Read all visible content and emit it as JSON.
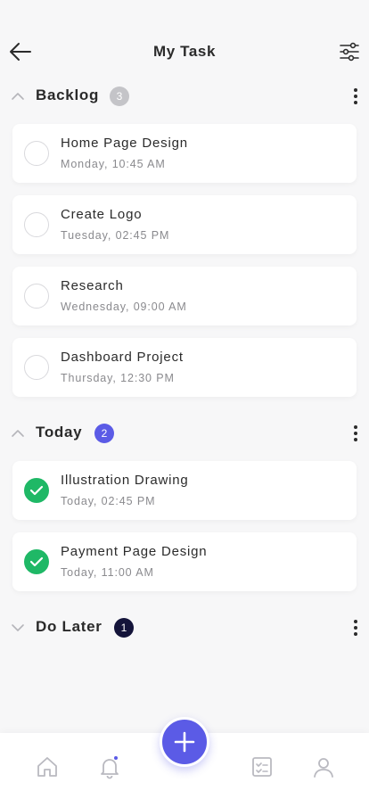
{
  "header": {
    "title": "My Task"
  },
  "sections": [
    {
      "label": "Backlog",
      "count": "3",
      "badge_color": "#c4c4c8",
      "expanded": true,
      "tasks": [
        {
          "name": "Home Page Design",
          "time": "Monday, 10:45 AM",
          "done": false
        },
        {
          "name": "Create Logo",
          "time": "Tuesday, 02:45 PM",
          "done": false
        },
        {
          "name": "Research",
          "time": "Wednesday, 09:00 AM",
          "done": false
        },
        {
          "name": "Dashboard Project",
          "time": "Thursday, 12:30 PM",
          "done": false
        }
      ]
    },
    {
      "label": "Today",
      "count": "2",
      "badge_color": "#5b5be6",
      "expanded": true,
      "tasks": [
        {
          "name": "Illustration Drawing",
          "time": "Today, 02:45 PM",
          "done": true
        },
        {
          "name": "Payment Page Design",
          "time": "Today, 11:00 AM",
          "done": true
        }
      ]
    },
    {
      "label": "Do Later",
      "count": "1",
      "badge_color": "#14143a",
      "expanded": false,
      "tasks": []
    }
  ],
  "colors": {
    "accent": "#5b5be6",
    "done_green": "#1fb866",
    "notification_dot": "#5b5be6"
  },
  "bottom_nav": {
    "items": [
      "home-icon",
      "bell-icon",
      "add-icon",
      "task-list-icon",
      "profile-icon"
    ]
  }
}
